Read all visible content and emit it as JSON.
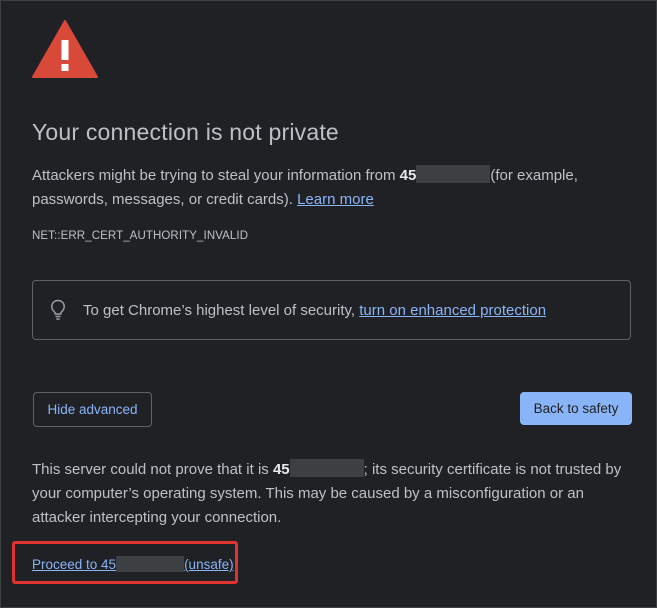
{
  "header": {
    "icon": "warning-triangle-icon",
    "title": "Your connection is not private"
  },
  "main_message": {
    "prefix": "Attackers might be trying to steal your information from ",
    "host": "45",
    "suffix": "(for example, passwords, messages, or credit cards). ",
    "learn_more": "Learn more"
  },
  "error_code": "NET::ERR_CERT_AUTHORITY_INVALID",
  "enhanced_protection": {
    "icon": "lightbulb-icon",
    "text": "To get Chrome’s highest level of security, ",
    "link": "turn on enhanced protection"
  },
  "buttons": {
    "hide_advanced": "Hide advanced",
    "back_to_safety": "Back to safety"
  },
  "details": {
    "prefix": "This server could not prove that it is ",
    "host": "45",
    "suffix": "; its security certificate is not trusted by your computer’s operating system. This may be caused by a misconfiguration or an attacker intercepting your connection."
  },
  "proceed": {
    "prefix": "Proceed to 45",
    "suffix": "(unsafe)"
  },
  "colors": {
    "background": "#202124",
    "text": "#bdc1c6",
    "link": "#8ab4f8",
    "warning_red": "#d93025",
    "highlight_box": "#e0322f"
  }
}
